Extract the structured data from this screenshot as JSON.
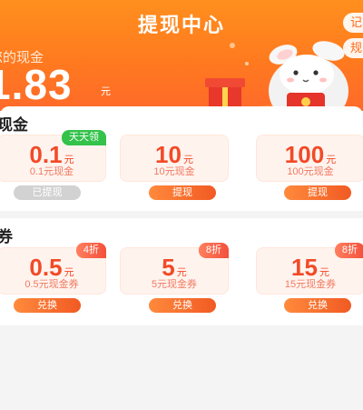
{
  "header": {
    "title": "提现中心",
    "record_label": "记",
    "rule_label": "规",
    "balance_label": "您的现金",
    "balance_value": "1.83",
    "balance_unit": "元"
  },
  "cash_section": {
    "title": "现金",
    "cards": [
      {
        "amount": "0.1",
        "unit": "元",
        "desc": "0.1元现金",
        "tag": "天天领",
        "button": "已提现",
        "disabled": true
      },
      {
        "amount": "10",
        "unit": "元",
        "desc": "10元现金",
        "tag": "",
        "button": "提现",
        "disabled": false
      },
      {
        "amount": "100",
        "unit": "元",
        "desc": "100元现金",
        "tag": "",
        "button": "提现",
        "disabled": false
      }
    ]
  },
  "coupon_section": {
    "title": "券",
    "cards": [
      {
        "amount": "0.5",
        "unit": "元",
        "desc": "0.5元现金券",
        "tag": "4折",
        "button": "兑换"
      },
      {
        "amount": "5",
        "unit": "元",
        "desc": "5元现金券",
        "tag": "8折",
        "button": "兑换"
      },
      {
        "amount": "15",
        "unit": "元",
        "desc": "15元现金券",
        "tag": "8折",
        "button": "兑换"
      }
    ]
  }
}
